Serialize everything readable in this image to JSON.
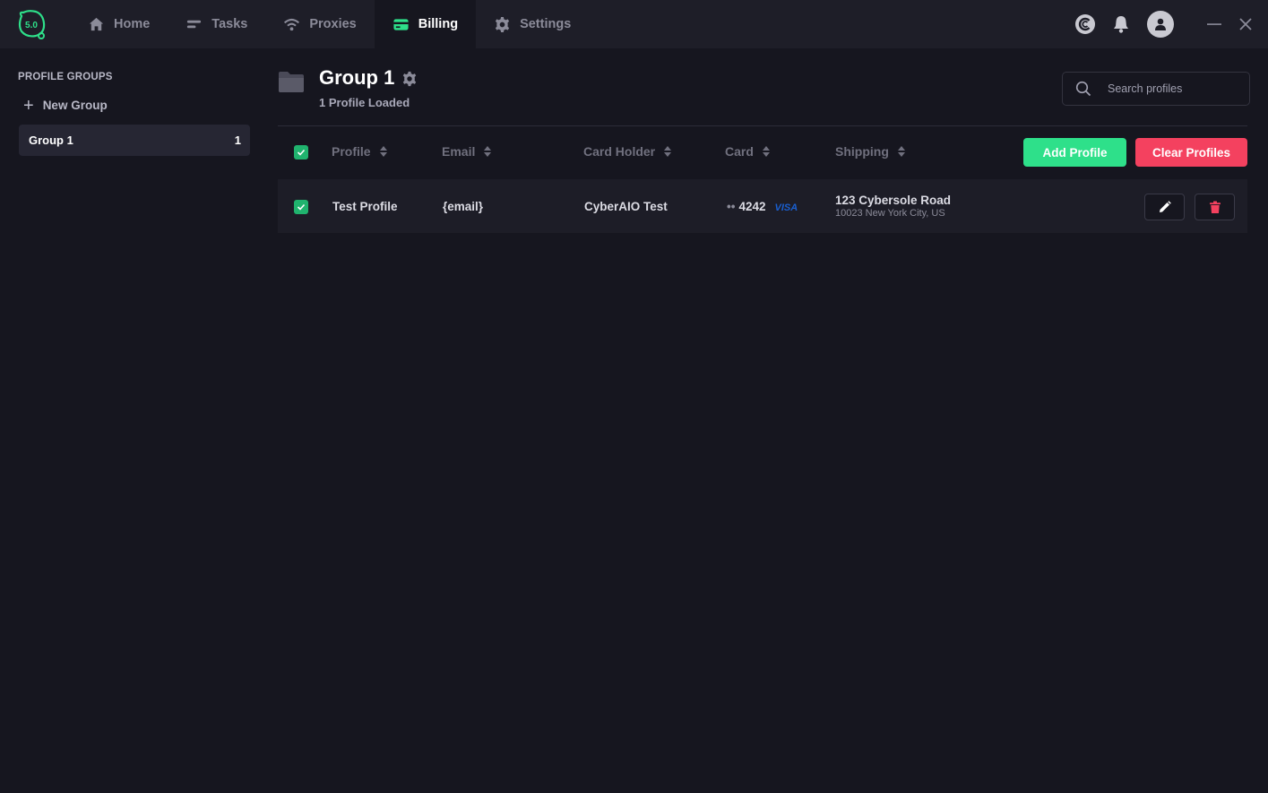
{
  "app": {
    "logo_text": "5.0",
    "accent": "#2ee08a",
    "danger": "#f4415f"
  },
  "nav": {
    "items": [
      {
        "label": "Home",
        "icon": "home-icon"
      },
      {
        "label": "Tasks",
        "icon": "tasks-icon"
      },
      {
        "label": "Proxies",
        "icon": "wifi-icon"
      },
      {
        "label": "Billing",
        "icon": "card-icon",
        "active": true
      },
      {
        "label": "Settings",
        "icon": "gear-icon"
      }
    ]
  },
  "sidebar": {
    "heading": "PROFILE GROUPS",
    "new_group_label": "New Group",
    "groups": [
      {
        "name": "Group 1",
        "count": "1"
      }
    ]
  },
  "main": {
    "title": "Group 1",
    "subtitle": "1 Profile Loaded",
    "search_placeholder": "Search profiles",
    "columns": [
      "Profile",
      "Email",
      "Card Holder",
      "Card",
      "Shipping"
    ],
    "add_label": "Add Profile",
    "clear_label": "Clear Profiles",
    "rows": [
      {
        "profile": "Test Profile",
        "email": "{email}",
        "card_holder": "CyberAIO Test",
        "card_dots": "••",
        "card_last4": "4242",
        "card_brand": "VISA",
        "address_line1": "123 Cybersole Road",
        "address_line2": "10023 New York City, US"
      }
    ]
  }
}
